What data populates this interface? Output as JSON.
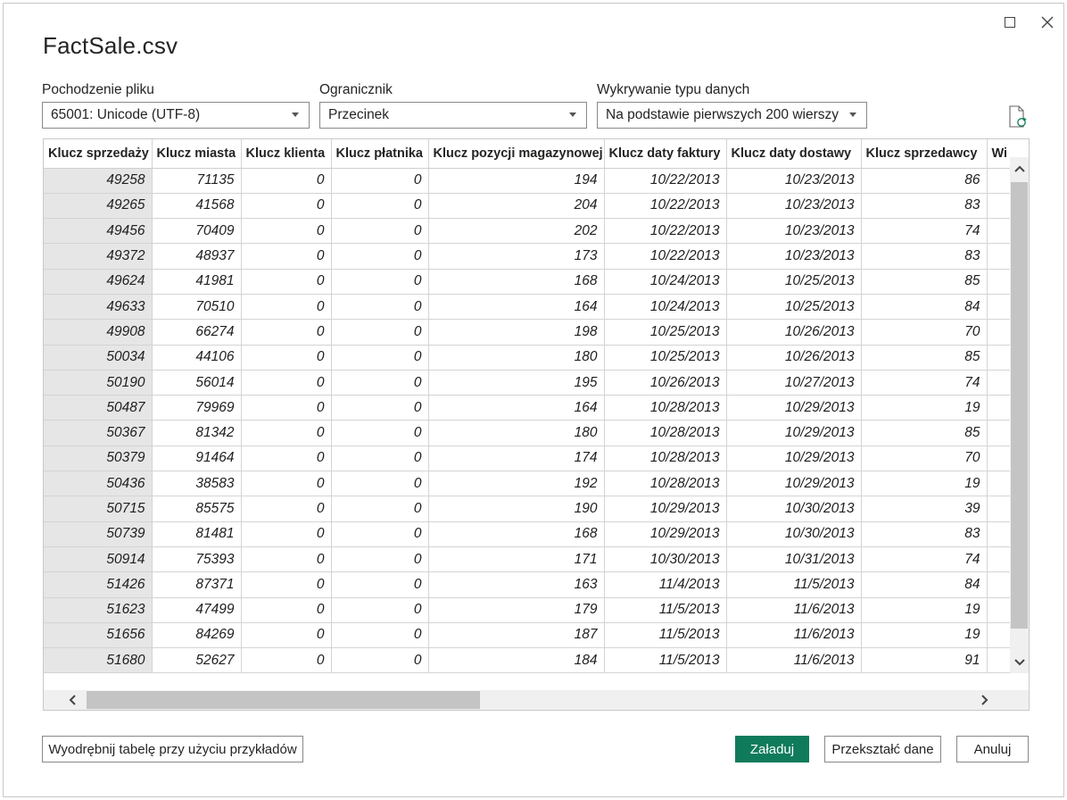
{
  "window": {
    "title": "FactSale.csv",
    "maximize_icon": "maximize-icon",
    "close_icon": "close-icon"
  },
  "options": {
    "file_origin": {
      "label": "Pochodzenie pliku",
      "value": "65001: Unicode (UTF-8)"
    },
    "delimiter": {
      "label": "Ogranicznik",
      "value": "Przecinek"
    },
    "type_detection": {
      "label": "Wykrywanie typu danych",
      "value": "Na podstawie pierwszych 200 wierszy"
    },
    "refresh_icon": "document-refresh-icon"
  },
  "table": {
    "columns": [
      "Klucz sprzedaży",
      "Klucz miasta",
      "Klucz klienta",
      "Klucz płatnika",
      "Klucz pozycji magazynowej",
      "Klucz daty faktury",
      "Klucz daty dostawy",
      "Klucz sprzedawcy",
      "Wi"
    ],
    "rows": [
      [
        "49258",
        "71135",
        "0",
        "0",
        "194",
        "10/22/2013",
        "10/23/2013",
        "86"
      ],
      [
        "49265",
        "41568",
        "0",
        "0",
        "204",
        "10/22/2013",
        "10/23/2013",
        "83"
      ],
      [
        "49456",
        "70409",
        "0",
        "0",
        "202",
        "10/22/2013",
        "10/23/2013",
        "74"
      ],
      [
        "49372",
        "48937",
        "0",
        "0",
        "173",
        "10/22/2013",
        "10/23/2013",
        "83"
      ],
      [
        "49624",
        "41981",
        "0",
        "0",
        "168",
        "10/24/2013",
        "10/25/2013",
        "85"
      ],
      [
        "49633",
        "70510",
        "0",
        "0",
        "164",
        "10/24/2013",
        "10/25/2013",
        "84"
      ],
      [
        "49908",
        "66274",
        "0",
        "0",
        "198",
        "10/25/2013",
        "10/26/2013",
        "70"
      ],
      [
        "50034",
        "44106",
        "0",
        "0",
        "180",
        "10/25/2013",
        "10/26/2013",
        "85"
      ],
      [
        "50190",
        "56014",
        "0",
        "0",
        "195",
        "10/26/2013",
        "10/27/2013",
        "74"
      ],
      [
        "50487",
        "79969",
        "0",
        "0",
        "164",
        "10/28/2013",
        "10/29/2013",
        "19"
      ],
      [
        "50367",
        "81342",
        "0",
        "0",
        "180",
        "10/28/2013",
        "10/29/2013",
        "85"
      ],
      [
        "50379",
        "91464",
        "0",
        "0",
        "174",
        "10/28/2013",
        "10/29/2013",
        "70"
      ],
      [
        "50436",
        "38583",
        "0",
        "0",
        "192",
        "10/28/2013",
        "10/29/2013",
        "19"
      ],
      [
        "50715",
        "85575",
        "0",
        "0",
        "190",
        "10/29/2013",
        "10/30/2013",
        "39"
      ],
      [
        "50739",
        "81481",
        "0",
        "0",
        "168",
        "10/29/2013",
        "10/30/2013",
        "83"
      ],
      [
        "50914",
        "75393",
        "0",
        "0",
        "171",
        "10/30/2013",
        "10/31/2013",
        "74"
      ],
      [
        "51426",
        "87371",
        "0",
        "0",
        "163",
        "11/4/2013",
        "11/5/2013",
        "84"
      ],
      [
        "51623",
        "47499",
        "0",
        "0",
        "179",
        "11/5/2013",
        "11/6/2013",
        "19"
      ],
      [
        "51656",
        "84269",
        "0",
        "0",
        "187",
        "11/5/2013",
        "11/6/2013",
        "19"
      ],
      [
        "51680",
        "52627",
        "0",
        "0",
        "184",
        "11/5/2013",
        "11/6/2013",
        "91"
      ]
    ],
    "scroll_up_icon": "chevron-up-icon",
    "scroll_down_icon": "chevron-down-icon",
    "scroll_left_icon": "chevron-left-icon",
    "scroll_right_icon": "chevron-right-icon"
  },
  "buttons": {
    "extract": "Wyodrębnij tabelę przy użyciu przykładów",
    "load": "Załaduj",
    "transform": "Przekształć dane",
    "cancel": "Anuluj"
  },
  "colors": {
    "primary": "#0f7b5b",
    "first_column_bg": "#e6e6e6",
    "scrollbar_thumb": "#c4c4c4"
  }
}
